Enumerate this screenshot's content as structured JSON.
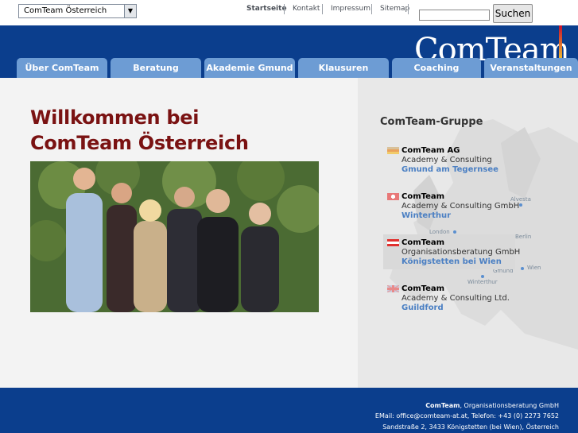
{
  "country_select": {
    "value": "ComTeam Österreich"
  },
  "top_nav": [
    "Startseite",
    "Kontakt",
    "Impressum",
    "Sitemap"
  ],
  "search": {
    "button_label": "Suchen",
    "value": ""
  },
  "logo_text": "ComTeam",
  "tabs": [
    "Über ComTeam",
    "Beratung",
    "Akademie Gmund",
    "Klausuren",
    "Coaching",
    "Veranstaltungen"
  ],
  "heading": {
    "line1": "Willkommen bei",
    "line2": "ComTeam Österreich"
  },
  "group": {
    "title": "ComTeam-Gruppe",
    "companies": [
      {
        "name": "ComTeam AG",
        "desc": "Academy & Consulting",
        "location": "Gmund am Tegernsee",
        "flag": "germany"
      },
      {
        "name": "ComTeam",
        "desc": "Academy & Consulting GmbH",
        "location": "Winterthur",
        "flag": "switzerland"
      },
      {
        "name": "ComTeam",
        "desc": "Organisationsberatung GmbH",
        "location": "Königstetten bei Wien",
        "flag": "austria"
      },
      {
        "name": "ComTeam",
        "desc": "Academy & Consulting Ltd.",
        "location": "Guildford",
        "flag": "uk"
      }
    ],
    "map_labels": [
      "Alvesta",
      "London",
      "Berlin",
      "Wien",
      "Gmund",
      "Winterthur"
    ]
  },
  "footer": {
    "line1_company": "ComTeam",
    "line1_rest": ", Organisationsberatung GmbH",
    "line2": "EMail: office@comteam-at.at, Telefon: +43 (0) 2273 7652",
    "line3": "Sandstraße 2, 3433 Königstetten (bei Wien), Österreich"
  },
  "colors": {
    "brand_blue": "#0b3e8d",
    "tab_blue": "#6d9cd4",
    "heading_red": "#7a1212",
    "link_blue": "#4a7fc3"
  }
}
